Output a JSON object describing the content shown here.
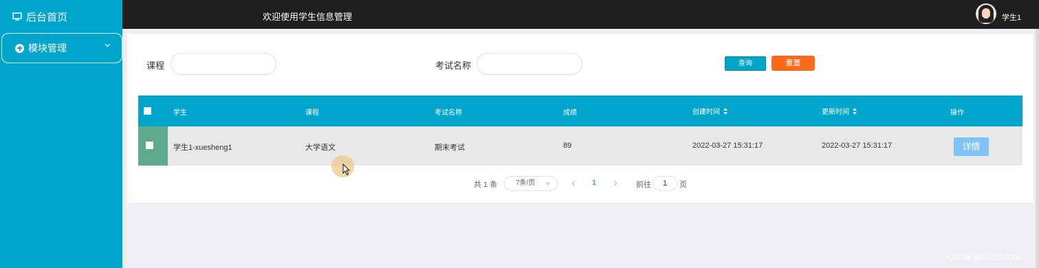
{
  "sidebar": {
    "home_label": "后台首页",
    "module_label": "模块管理"
  },
  "header": {
    "title": "欢迎使用学生信息管理",
    "username": "学生1"
  },
  "search": {
    "course_label": "课程",
    "course_value": "",
    "exam_label": "考试名称",
    "exam_value": "",
    "query_button": "查询",
    "reset_button": "重置"
  },
  "table": {
    "columns": [
      "学生",
      "课程",
      "考试名称",
      "成绩",
      "创建时间",
      "更新时间",
      "操作"
    ],
    "rows": [
      {
        "student": "学生1-xuesheng1",
        "course": "大学语文",
        "exam": "期末考试",
        "score": "89",
        "created": "2022-03-27 15:31:17",
        "updated": "2022-03-27 15:31:17",
        "action": "详情"
      }
    ]
  },
  "pagination": {
    "total": "共 1 条",
    "page_size": "7条/页",
    "current_page": "1",
    "goto_label": "前往",
    "goto_value": "1",
    "page_suffix": "页"
  },
  "watermark": "CSDN @DZBS2000",
  "colors": {
    "accent": "#00a5cc",
    "topbar": "#1f1f1f",
    "reset": "#ff6a1a",
    "detail": "#80c3f7",
    "selected_cell": "#5fa98c"
  }
}
